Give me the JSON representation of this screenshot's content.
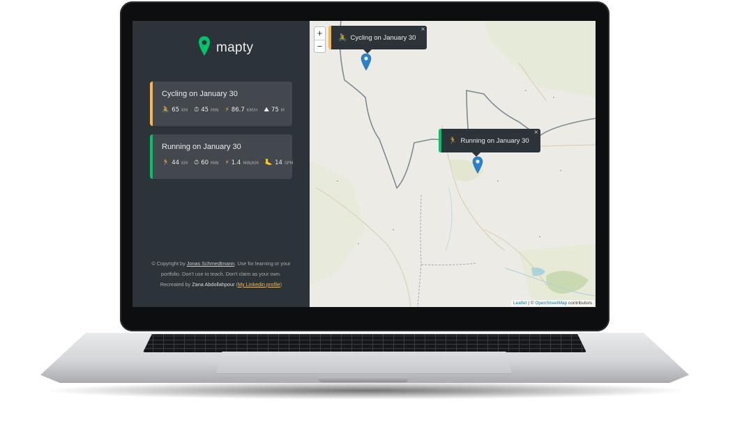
{
  "app": {
    "name": "mapty",
    "brand_color": "#00c46a"
  },
  "colors": {
    "cycling": "#ffb545",
    "running": "#00c46a",
    "sidebar_bg": "#2d3439",
    "card_bg": "#42484d"
  },
  "workouts": [
    {
      "type": "cycling",
      "title": "Cycling on January 30",
      "distance": "65",
      "distance_unit": "KM",
      "duration": "45",
      "duration_unit": "MIN",
      "speed": "86.7",
      "speed_unit": "KM/H",
      "elevation": "75",
      "elevation_unit": "M",
      "icons": [
        "cyclist-icon",
        "stopwatch-icon",
        "lightning-icon",
        "mountain-icon"
      ]
    },
    {
      "type": "running",
      "title": "Running on January 30",
      "distance": "44",
      "distance_unit": "KM",
      "duration": "60",
      "duration_unit": "MIN",
      "pace": "1.4",
      "pace_unit": "MIN/KM",
      "cadence": "14",
      "cadence_unit": "SPM",
      "icons": [
        "runner-icon",
        "stopwatch-icon",
        "lightning-icon",
        "footprint-icon"
      ]
    }
  ],
  "copyright": {
    "prefix": "© Copyright by ",
    "author": "Jonas Schmedtmann",
    "body": ". Use for learning or your portfolio. Don't use to teach. Don't claim as your own. Recreated by ",
    "recreator": "Zana Abdollahpour",
    "paren_open": " (",
    "linkedin": "My Linkedin profile",
    "paren_close": ")"
  },
  "map": {
    "zoom_in": "+",
    "zoom_out": "−",
    "popups": [
      {
        "type": "cycling",
        "text": "Cycling on January 30",
        "close": "×"
      },
      {
        "type": "running",
        "text": "Running on January 30",
        "close": "×"
      }
    ],
    "attribution": {
      "leaflet": "Leaflet",
      "sep": " | © ",
      "osm": "OpenStreetMap",
      "suffix": " contributors"
    },
    "marker_color": "#2a81cb"
  }
}
